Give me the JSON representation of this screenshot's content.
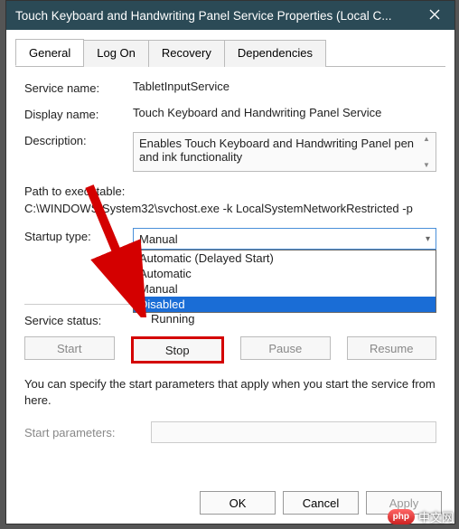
{
  "titlebar": {
    "title": "Touch Keyboard and Handwriting Panel Service Properties (Local C..."
  },
  "tabs": {
    "general": "General",
    "logon": "Log On",
    "recovery": "Recovery",
    "dependencies": "Dependencies"
  },
  "general": {
    "service_name_label": "Service name:",
    "service_name_value": "TabletInputService",
    "display_name_label": "Display name:",
    "display_name_value": "Touch Keyboard and Handwriting Panel Service",
    "description_label": "Description:",
    "description_value": "Enables Touch Keyboard and Handwriting Panel pen and ink functionality",
    "path_label": "Path to executable:",
    "path_value": "C:\\WINDOWS\\System32\\svchost.exe -k LocalSystemNetworkRestricted -p",
    "startup_type_label": "Startup type:",
    "startup_type_value": "Manual",
    "startup_options": {
      "auto_delayed": "Automatic (Delayed Start)",
      "auto": "Automatic",
      "manual": "Manual",
      "disabled": "Disabled"
    },
    "service_status_label": "Service status:",
    "service_status_value": "Running",
    "buttons": {
      "start": "Start",
      "stop": "Stop",
      "pause": "Pause",
      "resume": "Resume"
    },
    "note_text": "You can specify the start parameters that apply when you start the service from here.",
    "start_parameters_label": "Start parameters:",
    "start_parameters_value": ""
  },
  "footer": {
    "ok": "OK",
    "cancel": "Cancel",
    "apply": "Apply"
  },
  "watermark": {
    "badge": "php",
    "text": "中文网"
  }
}
